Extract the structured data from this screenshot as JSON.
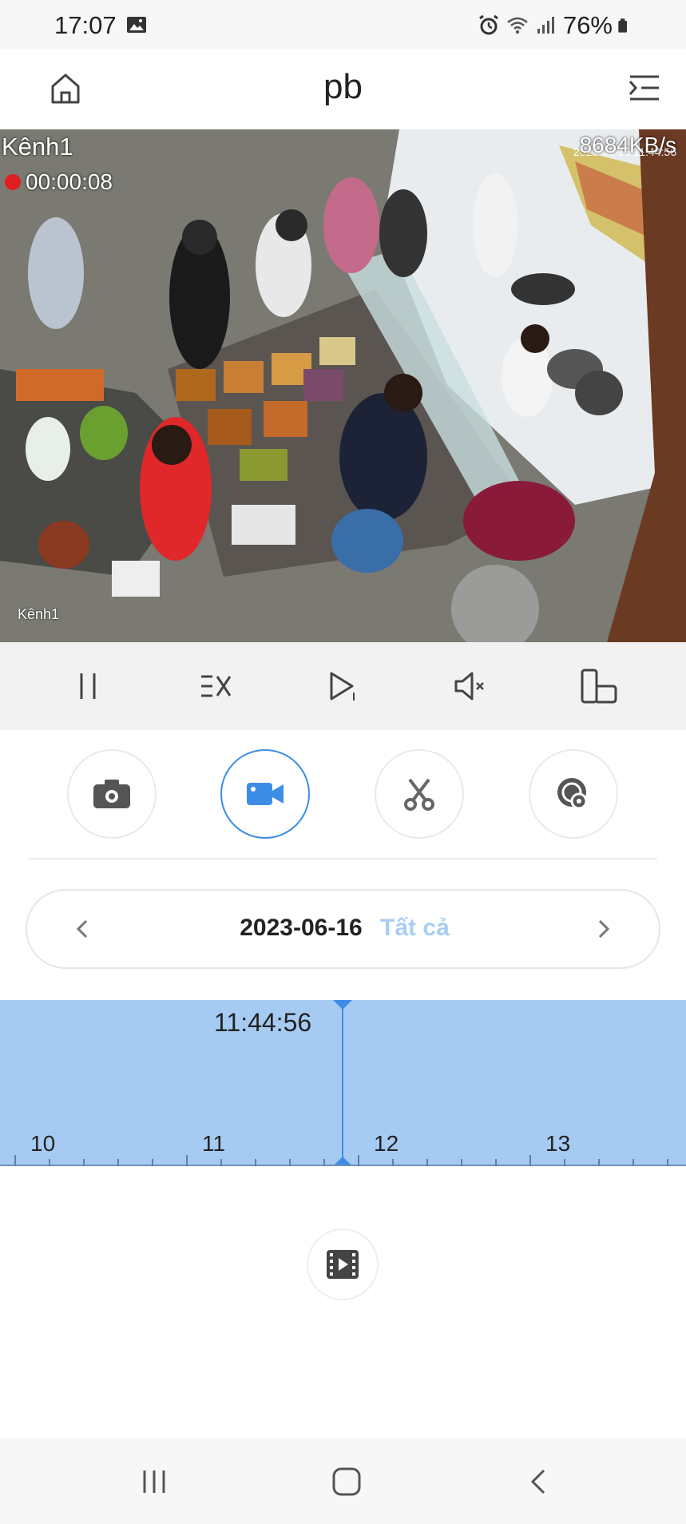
{
  "status_bar": {
    "time": "17:07",
    "battery": "76%",
    "icons": [
      "gallery-icon",
      "alarm-icon",
      "wifi-icon",
      "signal-icon",
      "battery-icon"
    ]
  },
  "header": {
    "title": "pb",
    "left_icon": "home-icon",
    "right_icon": "menu-collapse-icon"
  },
  "video": {
    "channel_label": "Kênh1",
    "record_timer": "00:00:08",
    "bitrate": "8684KB/s",
    "overlay_timestamp": "2023-06-16 11:44:56",
    "camera_label": "Kênh1"
  },
  "controls": {
    "buttons": [
      "pause-icon",
      "speed-icon",
      "frame-step-icon",
      "mute-icon",
      "fullscreen-rotate-icon"
    ]
  },
  "actions": {
    "buttons": [
      "snapshot-icon",
      "record-video-icon",
      "clip-scissors-icon",
      "playback-search-icon"
    ],
    "active": "record-video-icon"
  },
  "date_selector": {
    "date": "2023-06-16",
    "filter": "Tất cả"
  },
  "timeline": {
    "current_time": "11:44:56",
    "hours": [
      "10",
      "11",
      "12",
      "13"
    ]
  },
  "colors": {
    "accent": "#3d8de6",
    "timeline_fill": "#a6cbf3",
    "filter_text": "#a9cdf2",
    "control_bar": "#f2f2f2"
  }
}
